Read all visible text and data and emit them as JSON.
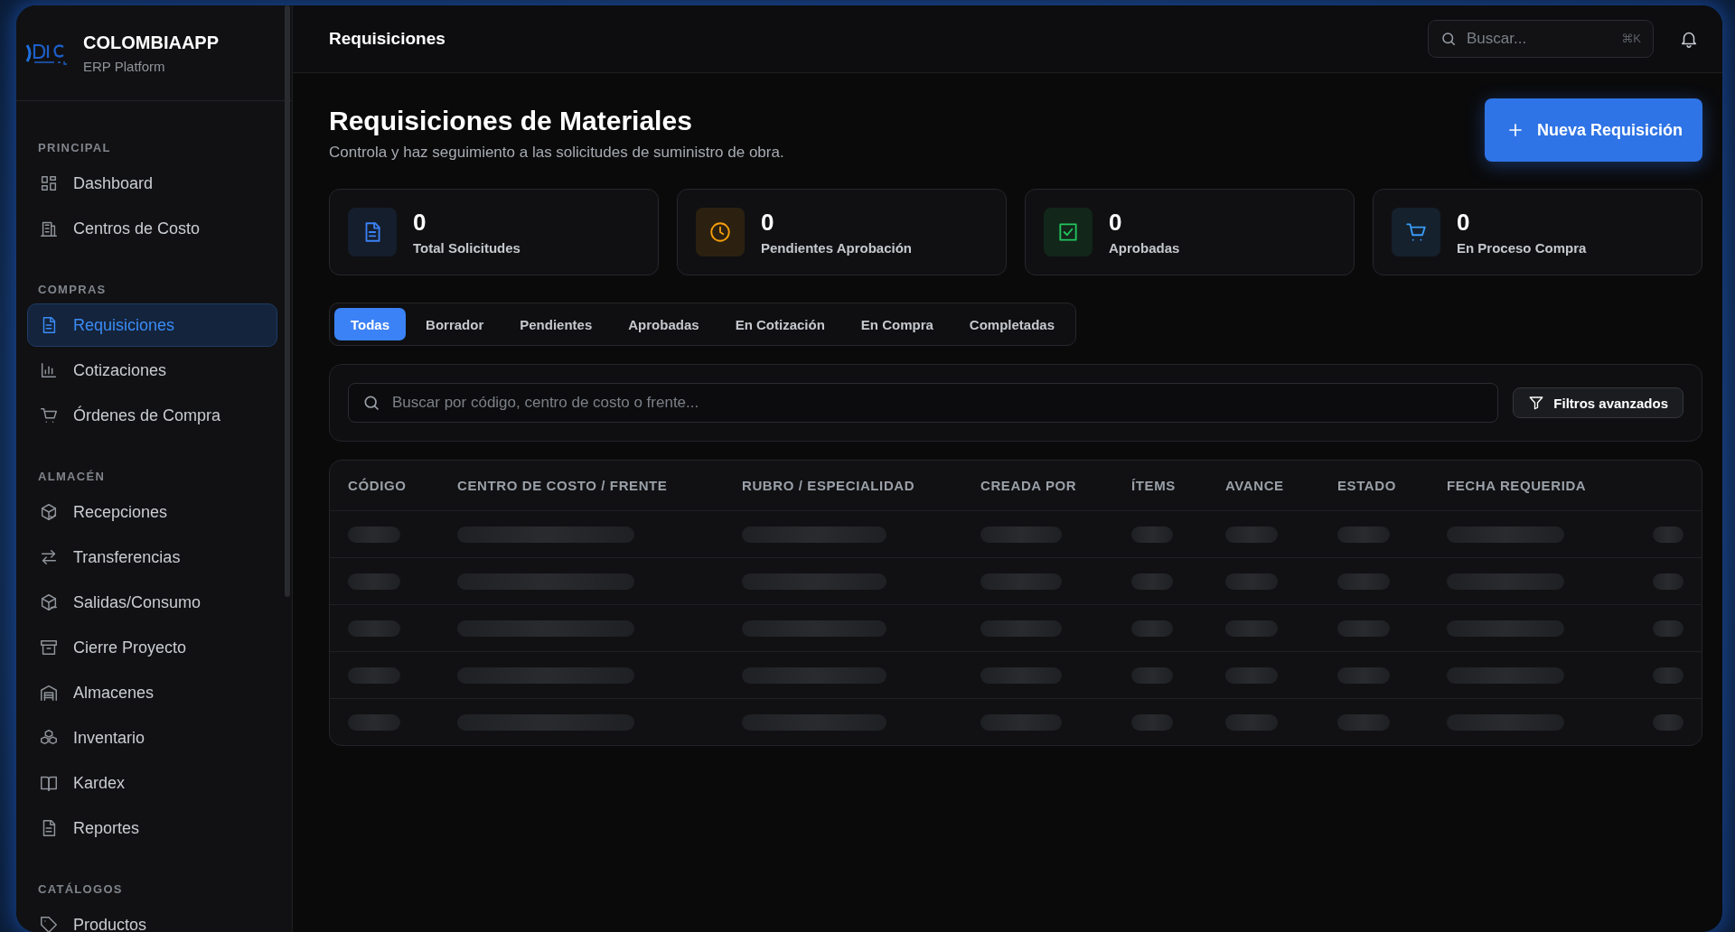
{
  "brand": {
    "name": "COLOMBIAAPP",
    "subtitle": "ERP Platform"
  },
  "sidebar": {
    "sections": [
      {
        "title": "PRINCIPAL",
        "items": [
          {
            "label": "Dashboard",
            "selected": false
          },
          {
            "label": "Centros de Costo",
            "selected": false
          }
        ]
      },
      {
        "title": "COMPRAS",
        "items": [
          {
            "label": "Requisiciones",
            "selected": true
          },
          {
            "label": "Cotizaciones",
            "selected": false
          },
          {
            "label": "Órdenes de Compra",
            "selected": false
          }
        ]
      },
      {
        "title": "ALMACÉN",
        "items": [
          {
            "label": "Recepciones",
            "selected": false
          },
          {
            "label": "Transferencias",
            "selected": false
          },
          {
            "label": "Salidas/Consumo",
            "selected": false
          },
          {
            "label": "Cierre Proyecto",
            "selected": false
          },
          {
            "label": "Almacenes",
            "selected": false
          },
          {
            "label": "Inventario",
            "selected": false
          },
          {
            "label": "Kardex",
            "selected": false
          },
          {
            "label": "Reportes",
            "selected": false
          }
        ]
      },
      {
        "title": "CATÁLOGOS",
        "items": [
          {
            "label": "Productos",
            "selected": false
          }
        ]
      }
    ]
  },
  "header": {
    "title": "Requisiciones",
    "search": {
      "placeholder": "Buscar...",
      "shortcut": "⌘K"
    }
  },
  "page": {
    "title": "Requisiciones de Materiales",
    "subtitle": "Controla y haz seguimiento a las solicitudes de suministro de obra.",
    "new_button": "Nueva Requisición"
  },
  "stats": [
    {
      "value": "0",
      "label": "Total Solicitudes",
      "color": "#3b82f6"
    },
    {
      "value": "0",
      "label": "Pendientes Aprobación",
      "color": "#f59e0b"
    },
    {
      "value": "0",
      "label": "Aprobadas",
      "color": "#22c55e"
    },
    {
      "value": "0",
      "label": "En Proceso Compra",
      "color": "#3b9cf6"
    }
  ],
  "tabs": [
    {
      "label": "Todas",
      "selected": true
    },
    {
      "label": "Borrador",
      "selected": false
    },
    {
      "label": "Pendientes",
      "selected": false
    },
    {
      "label": "Aprobadas",
      "selected": false
    },
    {
      "label": "En Cotización",
      "selected": false
    },
    {
      "label": "En Compra",
      "selected": false
    },
    {
      "label": "Completadas",
      "selected": false
    }
  ],
  "filter": {
    "placeholder": "Buscar por código, centro de costo o frente...",
    "button": "Filtros avanzados"
  },
  "table": {
    "columns": [
      "CÓDIGO",
      "CENTRO DE COSTO / FRENTE",
      "RUBRO / ESPECIALIDAD",
      "CREADA POR",
      "ÍTEMS",
      "AVANCE",
      "ESTADO",
      "FECHA REQUERIDA"
    ],
    "rows": [
      {
        "kind": "skeleton"
      },
      {
        "kind": "skeleton"
      },
      {
        "kind": "skeleton"
      },
      {
        "kind": "skeleton"
      },
      {
        "kind": "skeleton"
      }
    ]
  }
}
